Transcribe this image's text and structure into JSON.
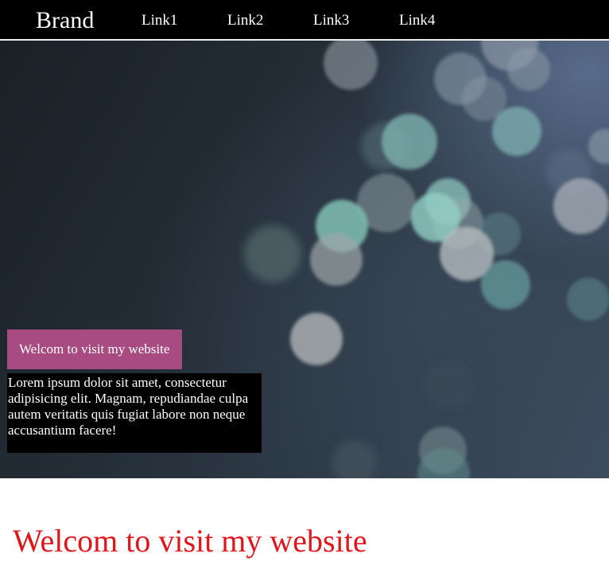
{
  "navbar": {
    "brand": "Brand",
    "links": [
      "Link1",
      "Link2",
      "Link3",
      "Link4"
    ]
  },
  "hero": {
    "badge_text": "Welcom to visit my website",
    "paragraph": "Lorem ipsum dolor sit amet, consectetur adipisicing elit. Magnam, repudiandae culpa autem veritatis quis fugiat labore non neque accusantium facere!"
  },
  "main": {
    "heading": "Welcom to visit my website"
  },
  "colors": {
    "navbar_bg": "#000000",
    "badge_bg": "#a84b82",
    "heading": "#e0161c",
    "text_box_bg": "#000000"
  }
}
